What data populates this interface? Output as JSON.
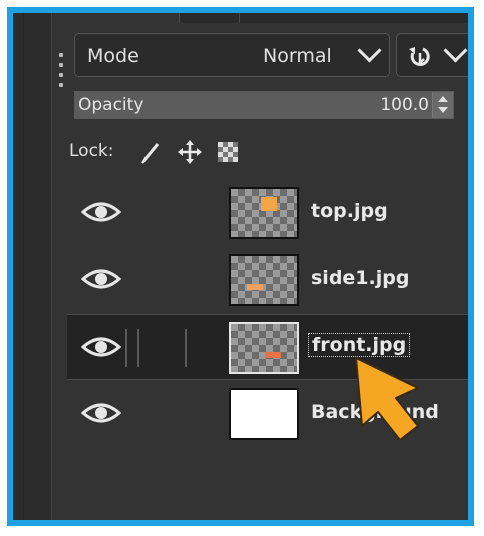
{
  "toolbar": {
    "mode_label": "Mode",
    "mode_value": "Normal",
    "mode_dropdown_icon": "chevron-down-icon",
    "composite_icon": "composite-mode-icon"
  },
  "opacity": {
    "label": "Opacity",
    "value": "100.0",
    "level_percent": 100
  },
  "lock": {
    "label": "Lock:",
    "icons": [
      "lock-pixels-icon",
      "lock-position-icon",
      "lock-alpha-icon"
    ]
  },
  "layers": [
    {
      "name": "top.jpg",
      "visible": true,
      "selected": false,
      "thumb_mark_color": "#f3a447"
    },
    {
      "name": "side1.jpg",
      "visible": true,
      "selected": false,
      "thumb_mark_color": "#f0a060"
    },
    {
      "name": "front.jpg",
      "visible": true,
      "selected": true,
      "thumb_mark_color": "#e8734a"
    },
    {
      "name": "Background",
      "visible": true,
      "selected": false,
      "thumb_mark_color": "#ffffff"
    }
  ],
  "colors": {
    "frame_accent": "#1fa0e3",
    "panel_bg": "#333333",
    "cursor_fill": "#f5a623"
  },
  "overlay": {
    "cursor_icon": "pointer-arrow-icon"
  }
}
